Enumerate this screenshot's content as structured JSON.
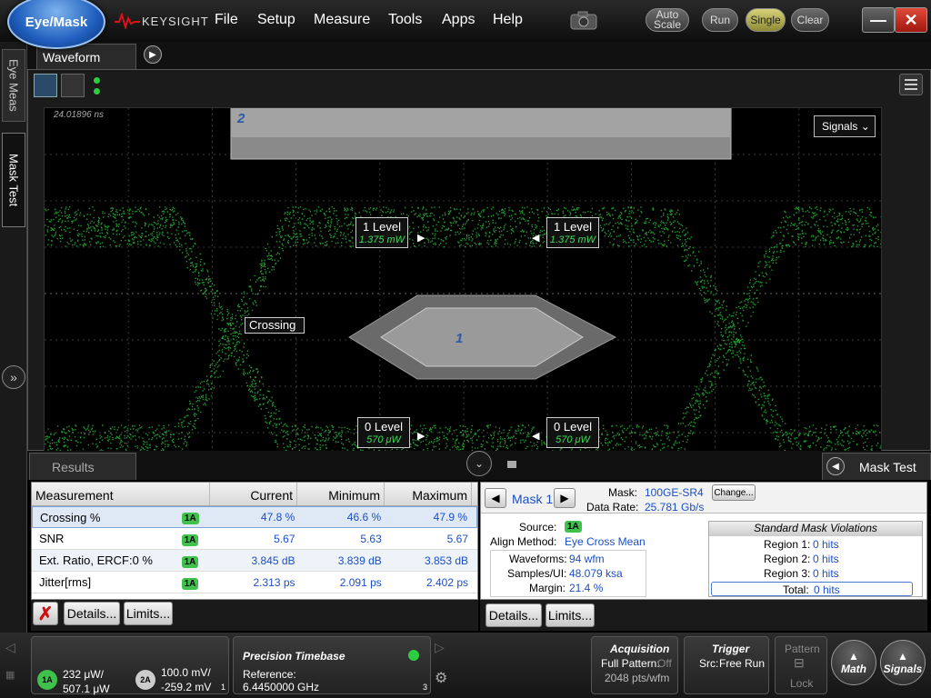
{
  "app": {
    "mode_button": "Eye/Mask",
    "brand": "KEYSIGHT"
  },
  "menu": [
    "File",
    "Setup",
    "Measure",
    "Tools",
    "Apps",
    "Help"
  ],
  "controls": {
    "auto_scale": "Auto Scale",
    "run": "Run",
    "single": "Single",
    "clear": "Clear",
    "minimize": "—",
    "close": "✕"
  },
  "left_tabs": [
    "Eye Meas",
    "Mask Test"
  ],
  "waveform": {
    "tab_label": "Waveform",
    "time_label": "24.01896 ns",
    "mask_top_label": "2",
    "mask_center_label": "1",
    "signals_label": "Signals",
    "one_level_label": "1 Level",
    "one_level_value": "1.375 mW",
    "zero_level_label": "0 Level",
    "zero_level_value": "570 μW",
    "crossing_label": "Crossing"
  },
  "results": {
    "tab_label": "Results",
    "headers": [
      "Measurement",
      "Current",
      "Minimum",
      "Maximum"
    ],
    "rows": [
      {
        "name": "Crossing %",
        "source": "1A",
        "current": "47.8 %",
        "minimum": "46.6 %",
        "maximum": "47.9 %"
      },
      {
        "name": "SNR",
        "source": "1A",
        "current": "5.67",
        "minimum": "5.63",
        "maximum": "5.67"
      },
      {
        "name": "Ext. Ratio, ERCF:0 %",
        "source": "1A",
        "current": "3.845 dB",
        "minimum": "3.839 dB",
        "maximum": "3.853 dB"
      },
      {
        "name": "Jitter[rms]",
        "source": "1A",
        "current": "2.313 ps",
        "minimum": "2.091 ps",
        "maximum": "2.402 ps"
      }
    ],
    "delete_label": "✗",
    "details_label": "Details...",
    "limits_label": "Limits..."
  },
  "mask_test": {
    "tab_label": "Mask Test",
    "mask_name": "Mask 1",
    "mask_label": "Mask:",
    "mask_value": "100GE-SR4",
    "change_label": "Change...",
    "data_rate_label": "Data Rate:",
    "data_rate_value": "25.781 Gb/s",
    "source_label": "Source:",
    "source_value": "1A",
    "align_label": "Align Method:",
    "align_value": "Eye Cross Mean",
    "waveforms_label": "Waveforms:",
    "waveforms_value": "94 wfm",
    "samples_label": "Samples/UI:",
    "samples_value": "48.079 ksa",
    "margin_label": "Margin:",
    "margin_value": "21.4 %",
    "violations_title": "Standard Mask Violations",
    "regions": [
      {
        "label": "Region 1:",
        "value": "0 hits"
      },
      {
        "label": "Region 2:",
        "value": "0 hits"
      },
      {
        "label": "Region 3:",
        "value": "0 hits"
      }
    ],
    "total_label": "Total:",
    "total_value": "0 hits",
    "details_label": "Details...",
    "limits_label": "Limits..."
  },
  "status": {
    "ch1_badge": "1A",
    "ch1_line1": "232 μW/",
    "ch1_line2": "507.1 μW",
    "ch2_badge": "2A",
    "ch2_line1": "100.0 mV/",
    "ch2_line2": "-259.2 mV",
    "slot1": "1",
    "timebase_title": "Precision Timebase",
    "timebase_ref_label": "Reference:",
    "timebase_ref_value": "6.4450000 GHz",
    "slot3": "3",
    "acq_title": "Acquisition",
    "acq_line1_label": "Full Pattern:",
    "acq_line1_value": "Off",
    "acq_line2": "2048 pts/wfm",
    "trigger_title": "Trigger",
    "trigger_line_label": "Src:",
    "trigger_line_value": "Free Run",
    "pattern_label": "Pattern",
    "lock_label": "Lock",
    "math_label": "Math",
    "signals_label": "Signals"
  },
  "colors": {
    "accent": "#1f5ebd",
    "eye_trace": "#2ecc40",
    "badge": "#3fc14b",
    "link_text": "#1a4ec7"
  }
}
